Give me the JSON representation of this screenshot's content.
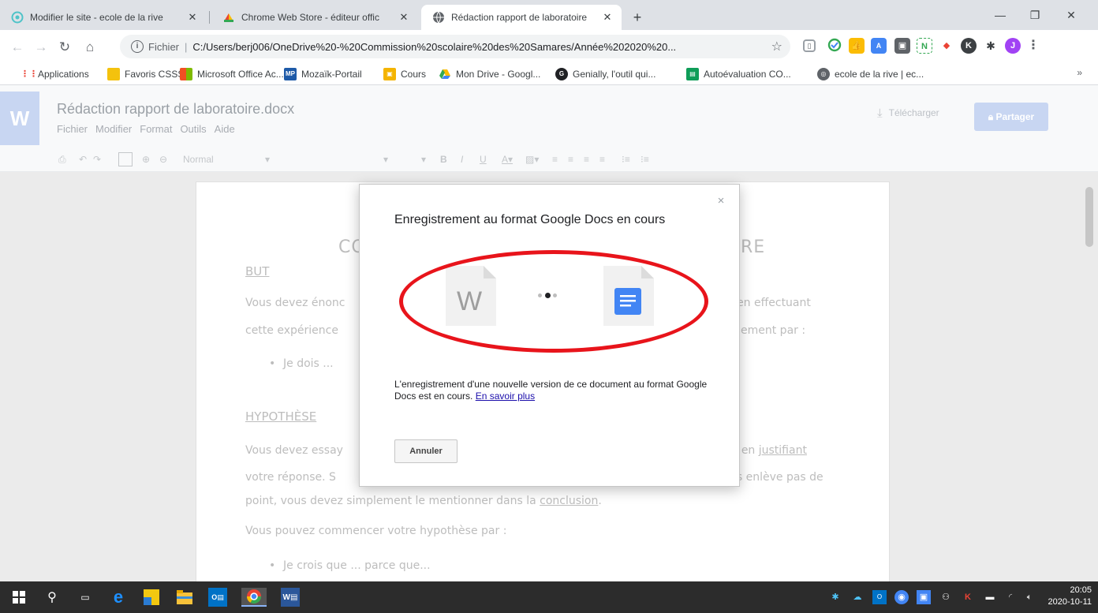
{
  "browser": {
    "tabs": [
      {
        "title": "Modifier le site - ecole de la rive",
        "active": false
      },
      {
        "title": "Chrome Web Store - éditeur offic",
        "active": false
      },
      {
        "title": "Rédaction rapport de laboratoire",
        "active": true
      }
    ],
    "new_tab_label": "+",
    "address": {
      "protocol": "Fichier",
      "url": "C:/Users/berj006/OneDrive%20-%20Commission%20scolaire%20des%20Samares/Année%202020%20..."
    },
    "bookmarks": [
      {
        "label": "Applications",
        "icon": "apps-grid-icon"
      },
      {
        "label": "Favoris CSSS",
        "icon": "folder-icon"
      },
      {
        "label": "Microsoft Office Ac...",
        "icon": "office-icon"
      },
      {
        "label": "Mozaïk-Portail",
        "icon": "mozaik-icon"
      },
      {
        "label": "Cours",
        "icon": "classroom-icon"
      },
      {
        "label": "Mon Drive - Googl...",
        "icon": "drive-icon"
      },
      {
        "label": "Genially, l'outil qui...",
        "icon": "genially-icon"
      },
      {
        "label": "Autoévaluation CO...",
        "icon": "sheet-icon"
      },
      {
        "label": "ecole de la rive | ec...",
        "icon": "globe-icon"
      }
    ],
    "bookmarks_more": "»"
  },
  "docs": {
    "app_logo": "W",
    "doc_title": "Rédaction rapport de laboratoire.docx",
    "menu": [
      "Fichier",
      "Modifier",
      "Format",
      "Outils",
      "Aide"
    ],
    "download_label": "Télécharger",
    "share_label": "Partager",
    "style_select": "Normal"
  },
  "document": {
    "title_left": "CO",
    "title_right": "RE",
    "section_but": "BUT",
    "line1_left": "Vous devez énonc",
    "line1_right": "e en effectuant",
    "line2_left": "cette expérience",
    "line2_right": "ement par :",
    "bullet1": "Je dois ...",
    "section_hyp": "HYPOTHÈSE",
    "line3_left": "Vous devez essay",
    "line3_right_pre": "ut en ",
    "line3_right_u": "justifiant",
    "line4_left": "votre réponse. S",
    "line4_right": "us enlève pas de",
    "line5_pre": "point, vous devez simplement le mentionner dans la ",
    "line5_u": "conclusion",
    "line5_post": ".",
    "line6": "Vous pouvez commencer votre hypothèse par :",
    "bullet2": "Je crois que ... parce que..."
  },
  "dialog": {
    "title": "Enregistrement au format Google Docs en cours",
    "word_letter": "W",
    "body": "L'enregistrement d'une nouvelle version de ce document au format Google Docs est en cours.",
    "link": "En savoir plus",
    "cancel_label": "Annuler",
    "close_label": "×"
  },
  "taskbar": {
    "time": "20:05",
    "date": "2020-10-11"
  },
  "colors": {
    "annotation": "#e8141b",
    "docs_blue": "#4285f4",
    "link": "#1a0dab"
  }
}
